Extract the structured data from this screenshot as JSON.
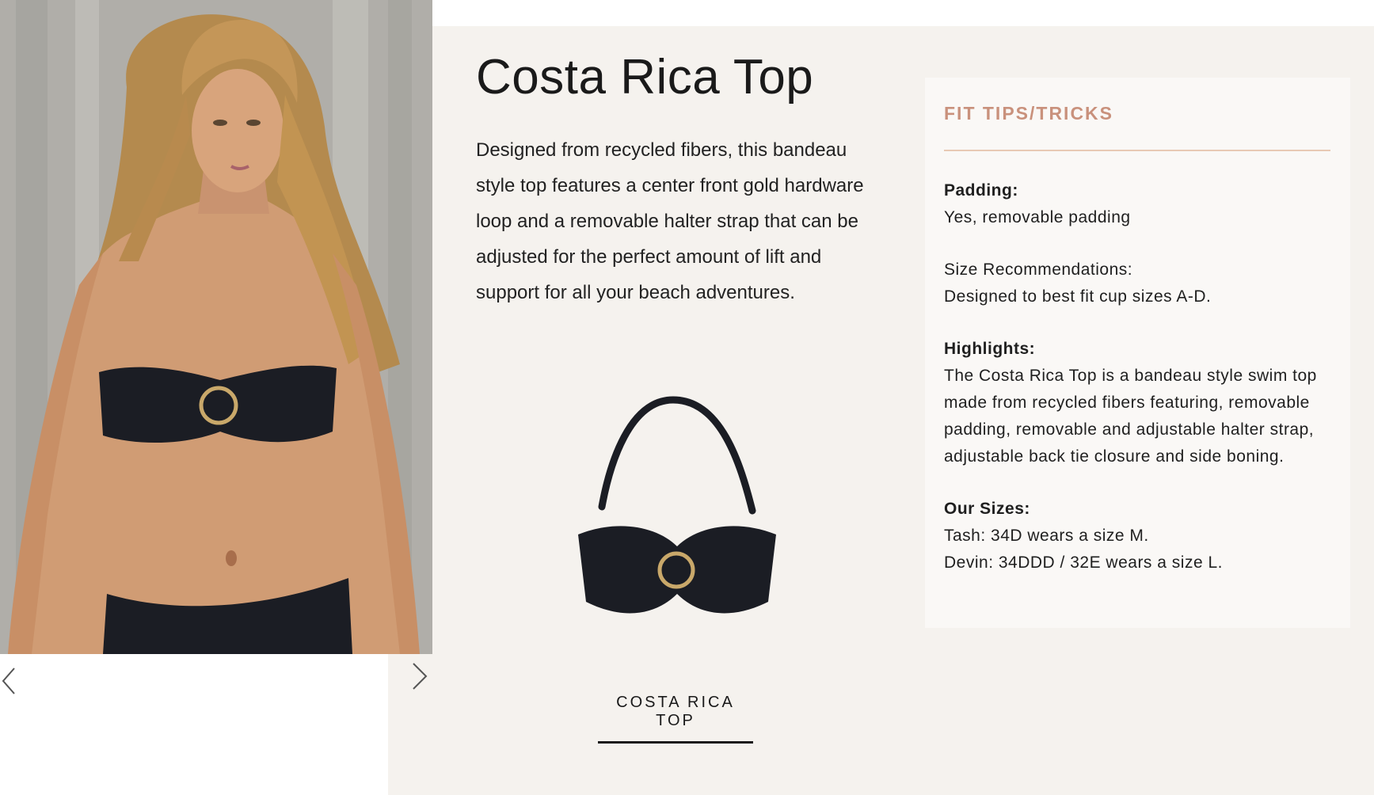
{
  "product": {
    "title": "Costa Rica Top",
    "description": "Designed from recycled fibers, this bandeau style top features a center front gold hardware loop and a removable halter strap that can be adjusted for the perfect amount of lift and support for all your beach adventures.",
    "link_label": "COSTA RICA TOP"
  },
  "gallery": {
    "prev_icon": "chevron-left-icon",
    "next_icon": "chevron-right-icon"
  },
  "fit_tips": {
    "heading": "FIT TIPS/TRICKS",
    "padding_label": "Padding:",
    "padding_value": "Yes, removable padding",
    "size_label": "Size Recommendations:",
    "size_value": "Designed to best fit cup sizes A-D.",
    "highlights_label": "Highlights:",
    "highlights_value": "The Costa Rica Top is a bandeau style swim top made from recycled fibers featuring, removable padding, removable and adjustable halter strap, adjustable back tie closure and side boning.",
    "sizes_label": "Our Sizes:",
    "sizes_line1": "Tash: 34D wears a size M.",
    "sizes_line2": "Devin: 34DDD / 32E wears a size L."
  },
  "colors": {
    "panel": "#f5f2ee",
    "card": "#faf8f6",
    "accent": "#c9917c",
    "swim": "#1b1d24",
    "gold": "#c9a86a"
  }
}
